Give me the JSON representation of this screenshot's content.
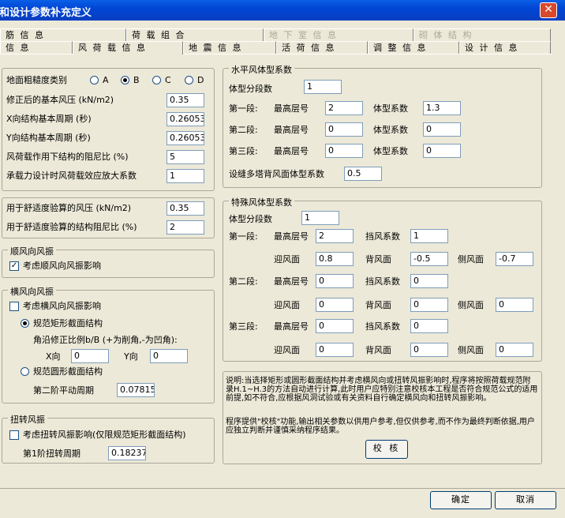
{
  "window": {
    "title": "荷和设计参数补充定义",
    "close_glyph": "✕"
  },
  "tabs_row1": [
    {
      "label": "筋 信 息",
      "disabled": false
    },
    {
      "label": "荷 载 组 合",
      "disabled": false
    },
    {
      "label": "地 下 室 信 息",
      "disabled": true
    },
    {
      "label": "砌 体 结 构",
      "disabled": true
    }
  ],
  "tabs_row2": [
    {
      "label": "信  息"
    },
    {
      "label": "风 荷 载 信 息"
    },
    {
      "label": "地 震 信 息"
    },
    {
      "label": "活 荷 信 息"
    },
    {
      "label": "调 整 信 息"
    },
    {
      "label": "设 计 信 息"
    }
  ],
  "wind": {
    "roughness_label": "地面粗糙度类别",
    "roughness_options": [
      "A",
      "B",
      "C",
      "D"
    ],
    "roughness_selected": "B",
    "pressure_label": "修正后的基本风压 (kN/m2)",
    "pressure": "0.35",
    "tx_label": "X向结构基本周期 (秒)",
    "tx": "0.26053",
    "ty_label": "Y向结构基本周期 (秒)",
    "ty": "0.26053",
    "damping_label": "风荷载作用下结构的阻尼比 (%)",
    "damping": "5",
    "amp_label": "承载力设计时风荷载效应放大系数",
    "amp": "1"
  },
  "comfort": {
    "pressure_label": "用于舒适度验算的风压 (kN/m2)",
    "pressure": "0.35",
    "damping_label": "用于舒适度验算的结构阻尼比 (%)",
    "damping": "2"
  },
  "along": {
    "title": "顺风向风振",
    "check_label": "考虑顺风向风振影响",
    "checked": true,
    "check_glyph": "✓"
  },
  "across": {
    "title": "横风向风振",
    "check_label": "考虑横风向风振影响",
    "checked": false,
    "rect_label": "规范矩形截面结构",
    "corner_label": "角沿修正比例b/B (+为削角,-为凹角):",
    "x_label": "X向",
    "x": "0",
    "y_label": "Y向",
    "y": "0",
    "circ_label": "规范圆形截面结构",
    "period2_label": "第二阶平动周期",
    "period2": "0.07815"
  },
  "torsion": {
    "title": "扭转风振",
    "check_label": "考虑扭转风振影响(仅限规范矩形截面结构)",
    "checked": false,
    "period_label": "第1阶扭转周期",
    "period": "0.18237"
  },
  "horiz": {
    "title": "水平风体型系数",
    "segcount_label": "体型分段数",
    "segcount": "1",
    "floor_label": "最高层号",
    "coef_label": "体型系数",
    "segments": [
      {
        "label": "第一段:",
        "floor": "2",
        "coef": "1.3"
      },
      {
        "label": "第二段:",
        "floor": "0",
        "coef": "0"
      },
      {
        "label": "第三段:",
        "floor": "0",
        "coef": "0"
      }
    ],
    "back_label": "设缝多塔背风面体型系数",
    "back": "0.5"
  },
  "special": {
    "title": "特殊风体型系数",
    "segcount_label": "体型分段数",
    "segcount": "1",
    "floor_label": "最高层号",
    "shield_label": "挡风系数",
    "windward_label": "迎风面",
    "leeward_label": "背风面",
    "side_label": "侧风面",
    "segments": [
      {
        "label": "第一段:",
        "floor": "2",
        "shield": "1",
        "windward": "0.8",
        "leeward": "-0.5",
        "side": "-0.7"
      },
      {
        "label": "第二段:",
        "floor": "0",
        "shield": "0",
        "windward": "0",
        "leeward": "0",
        "side": "0"
      },
      {
        "label": "第三段:",
        "floor": "0",
        "shield": "0",
        "windward": "0",
        "leeward": "0",
        "side": "0"
      }
    ]
  },
  "note": {
    "text1": "说明:当选择矩形或圆形截面结构并考虑横风向或扭转风振影响时,程序将按照荷载规范附录H.1~H.3的方法自动进行计算,此时用户应特别注意校核本工程是否符合规范公式的适用前提,如不符合,应根据风洞试验或有关资料自行确定横风向和扭转风振影响。",
    "text2": "程序提供\"校核\"功能,输出相关参数以供用户参考,但仅供参考,而不作为最终判断依据,用户应独立判断并谨慎采纳程序结果。",
    "verify_label": "校 核"
  },
  "footer": {
    "ok": "确定",
    "cancel": "取消"
  }
}
